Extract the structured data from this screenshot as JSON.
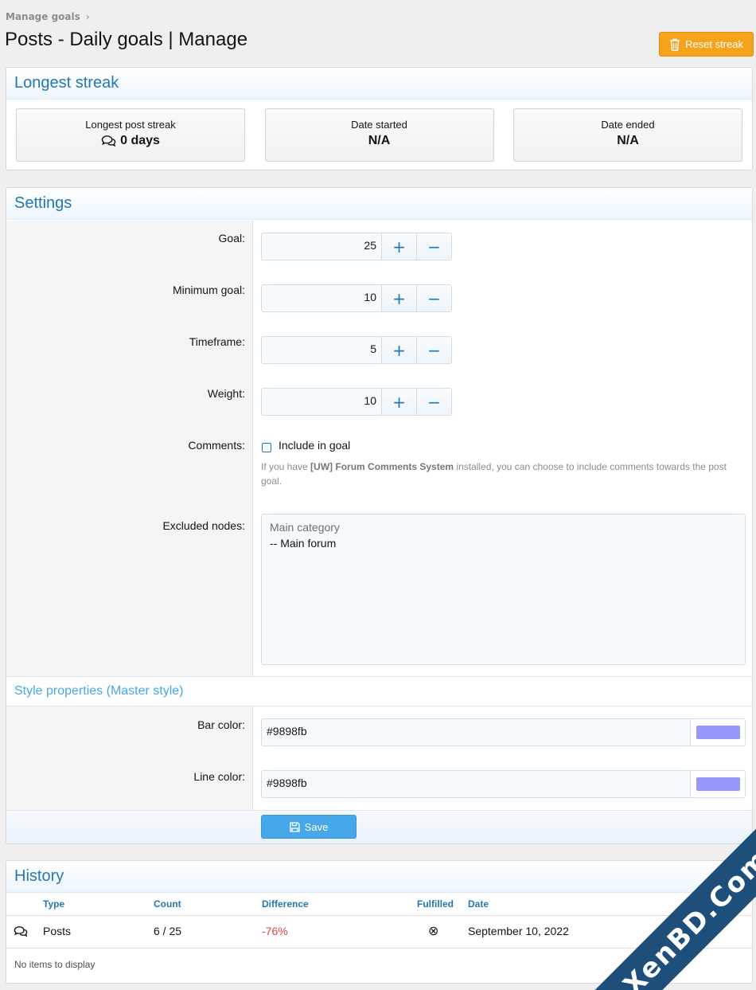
{
  "breadcrumb": {
    "item": "Manage goals",
    "chevron": "›"
  },
  "page": {
    "title": "Posts - Daily goals | Manage"
  },
  "reset_button": {
    "label": "Reset streak",
    "icon": "trash-icon",
    "color": "#f5a31a"
  },
  "streak": {
    "header": "Longest streak",
    "boxes": [
      {
        "label": "Longest post streak",
        "value": "0 days",
        "icon": "comments-icon"
      },
      {
        "label": "Date started",
        "value": "N/A"
      },
      {
        "label": "Date ended",
        "value": "N/A"
      }
    ]
  },
  "settings": {
    "header": "Settings",
    "fields": [
      {
        "label": "Goal:",
        "value": "25"
      },
      {
        "label": "Minimum goal:",
        "value": "10"
      },
      {
        "label": "Timeframe:",
        "value": "5"
      },
      {
        "label": "Weight:",
        "value": "10"
      }
    ],
    "stepper_plus": "+",
    "stepper_minus": "−",
    "comments": {
      "label": "Comments:",
      "checkbox_label": "Include in goal",
      "hint_pre": "If you have ",
      "hint_bold": "[UW] Forum Comments System",
      "hint_post": " installed, you can choose to include comments towards the post goal."
    },
    "excluded": {
      "label": "Excluded nodes:",
      "group": "Main category",
      "option": "-- Main forum"
    },
    "style_header": "Style properties (Master style)",
    "bar_color": {
      "label": "Bar color:",
      "value": "#9898fb"
    },
    "line_color": {
      "label": "Line color:",
      "value": "#9898fb"
    },
    "save_label": "Save"
  },
  "history": {
    "header": "History",
    "columns": [
      "Type",
      "Count",
      "Difference",
      "Fulfilled",
      "Date"
    ],
    "rows": [
      {
        "type": "Posts",
        "count": "6 / 25",
        "difference": "-76%",
        "fulfilled": "⊗",
        "date": "September 10, 2022"
      }
    ],
    "empty": "No items to display"
  },
  "watermark": "XenBD.Com"
}
